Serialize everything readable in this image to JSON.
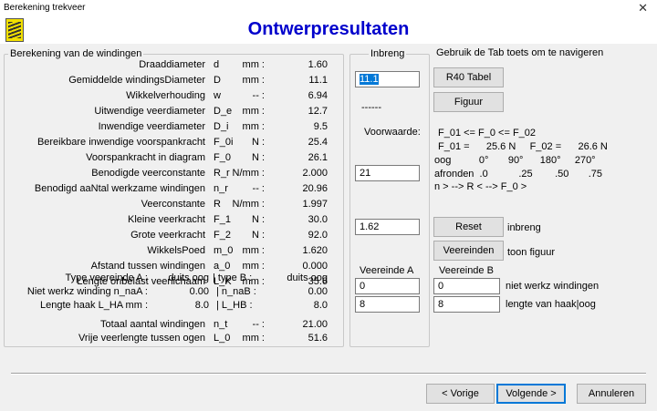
{
  "window": {
    "title": "Berekening trekveer",
    "close": "✕"
  },
  "header": {
    "title": "Ontwerpresultaten"
  },
  "left": {
    "legend": "Berekening van de windingen",
    "rows": [
      {
        "label": "Draaddiameter",
        "sym": "d",
        "unit": "mm :",
        "val": "1.60"
      },
      {
        "label": "Gemiddelde windingsDiameter",
        "sym": "D",
        "unit": "mm :",
        "val": "11.1"
      },
      {
        "label": "Wikkelverhouding",
        "sym": "w",
        "unit": "-- :",
        "val": "6.94"
      },
      {
        "label": "Uitwendige veerdiameter",
        "sym": "D_e",
        "unit": "mm :",
        "val": "12.7"
      },
      {
        "label": "Inwendige veerdiameter",
        "sym": "D_i",
        "unit": "mm :",
        "val": "9.5"
      },
      {
        "label": "Bereikbare inwendige voorspankracht",
        "sym": "F_0i",
        "unit": "N :",
        "val": "25.4"
      },
      {
        "label": "Voorspankracht in diagram",
        "sym": "F_0",
        "unit": "N :",
        "val": "26.1"
      },
      {
        "label": "Benodigde veerconstante",
        "sym": "R_r",
        "unit": "N/mm :",
        "val": "2.000"
      },
      {
        "label": "Benodigd aaNtal werkzame windingen",
        "sym": "n_r",
        "unit": "-- :",
        "val": "20.96"
      },
      {
        "label": "Veerconstante",
        "sym": "R",
        "unit": "N/mm :",
        "val": "1.997"
      },
      {
        "label": "Kleine veerkracht",
        "sym": "F_1",
        "unit": "N :",
        "val": "30.0"
      },
      {
        "label": "Grote veerkracht",
        "sym": "F_2",
        "unit": "N :",
        "val": "92.0"
      },
      {
        "label": "WikkelsPoed",
        "sym": "m_0",
        "unit": "mm :",
        "val": "1.620"
      },
      {
        "label": "Afstand tussen windingen",
        "sym": "a_0",
        "unit": "mm :",
        "val": "0.000"
      },
      {
        "label": "Lengte onbelast veerlichaam",
        "sym": "L_K",
        "unit": "mm :",
        "val": "35.6"
      }
    ],
    "type_row": {
      "label": "Type veereinde   A :",
      "a": "duits oog",
      "mid": "| type B :",
      "b": "duits oog"
    },
    "nw_row": {
      "label": "Niet werkz winding  n_naA :",
      "a": "0.00",
      "mid": "|  n_naB :",
      "b": "0.00"
    },
    "lh_row": {
      "label": "Lengte haak   L_HA  mm :",
      "a": "8.0",
      "mid": "|   L_HB :",
      "b": "8.0"
    },
    "total_row": {
      "label": "Totaal aantal windingen",
      "sym": "n_t",
      "unit": "-- :",
      "val": "21.00"
    },
    "vrij_row": {
      "label": "Vrije veerlengte tussen ogen",
      "sym": "L_0",
      "unit": "mm :",
      "val": "51.6"
    }
  },
  "mid": {
    "legend": "Inbreng",
    "input_d": "11.1",
    "dashes": "------",
    "voorwaarde": "Voorwaarde:",
    "input_nr": "21",
    "input_m0": "1.62",
    "veereinde_a": "Veereinde A",
    "input_na_a": "0",
    "input_lh_a": "8"
  },
  "right": {
    "hint": "Gebruik de Tab toets om te navigeren",
    "btn_r40": "R40 Tabel",
    "btn_figuur": "Figuur",
    "cond1": "F_01  <=  F_0  <=  F_02",
    "cond2": "F_01 =      25.6 N     F_02 =      26.6 N",
    "cond3": "oog          0°       90°      180°     270°",
    "cond4": "afronden  .0           .25        .50       .75",
    "cond5": "n > --> R < --> F_0 >",
    "btn_reset": "Reset",
    "reset_label": "inbreng",
    "btn_veereinden": "Veereinden",
    "veereinden_label": "toon figuur",
    "veereinde_b": "Veereinde B",
    "input_na_b": "0",
    "input_lh_b": "8",
    "na_label": "niet werkz windingen",
    "lh_label": "lengte van haak|oog"
  },
  "footer": {
    "prev": "< Vorige",
    "next": "Volgende >",
    "cancel": "Annuleren"
  }
}
